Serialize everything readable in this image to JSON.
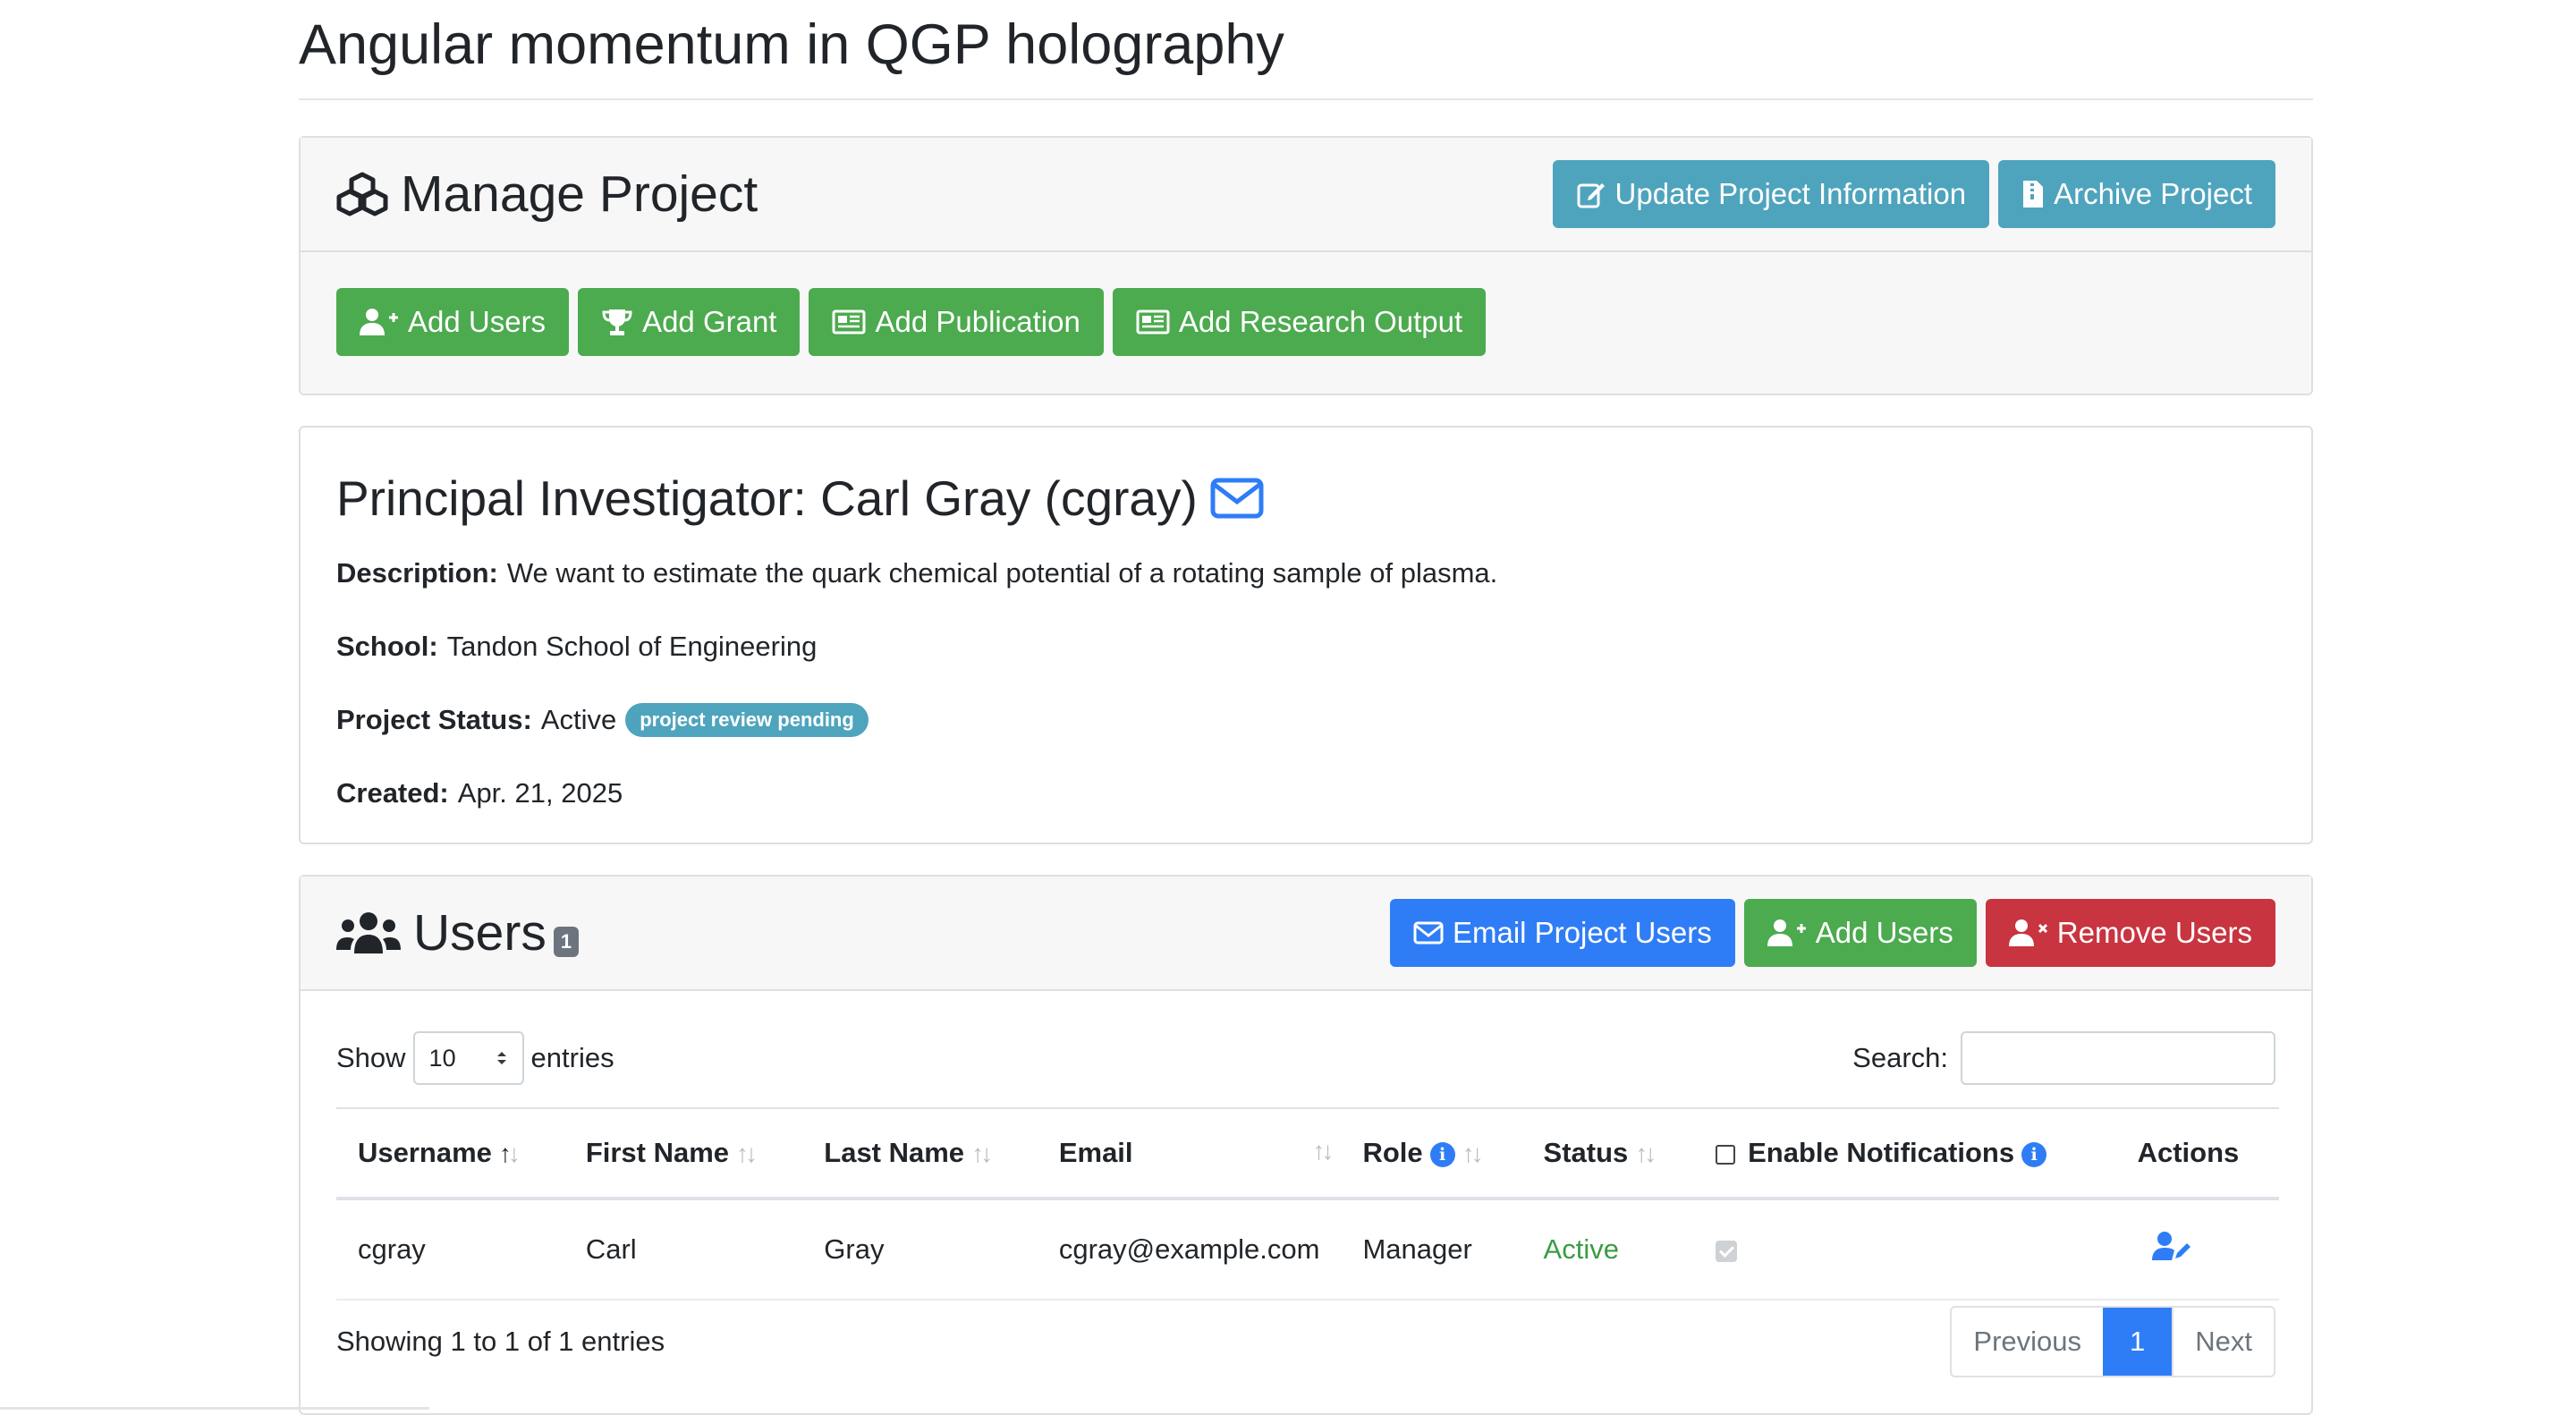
{
  "page": {
    "title": "Angular momentum in QGP holography"
  },
  "manage": {
    "title": "Manage Project",
    "update_label": "Update Project Information",
    "archive_label": "Archive Project",
    "add_users_label": "Add Users",
    "add_grant_label": "Add Grant",
    "add_publication_label": "Add Publication",
    "add_research_output_label": "Add Research Output"
  },
  "pi": {
    "heading": "Principal Investigator: Carl Gray (cgray)",
    "description_label": "Description:",
    "description": "We want to estimate the quark chemical potential of a rotating sample of plasma.",
    "school_label": "School:",
    "school": "Tandon School of Engineering",
    "status_label": "Project Status:",
    "status": "Active",
    "status_badge": "project review pending",
    "created_label": "Created:",
    "created": "Apr. 21, 2025"
  },
  "users": {
    "title": "Users",
    "count": "1",
    "email_label": "Email Project Users",
    "add_label": "Add Users",
    "remove_label": "Remove Users",
    "show_label": "Show",
    "page_size": "10",
    "entries_label": "entries",
    "search_label": "Search:",
    "columns": [
      "Username",
      "First Name",
      "Last Name",
      "Email",
      "Role",
      "Status",
      "Enable Notifications",
      "Actions"
    ],
    "rows": [
      {
        "username": "cgray",
        "first_name": "Carl",
        "last_name": "Gray",
        "email": "cgray@example.com",
        "role": "Manager",
        "status": "Active",
        "notifications_enabled": true
      }
    ],
    "info": "Showing 1 to 1 of 1 entries",
    "prev_label": "Previous",
    "current_page": "1",
    "next_label": "Next"
  },
  "colors": {
    "info": "#4fa4bd",
    "success": "#4caa4f",
    "primary": "#2f7df6",
    "danger": "#c8343f",
    "active_text": "#3a9c44"
  }
}
